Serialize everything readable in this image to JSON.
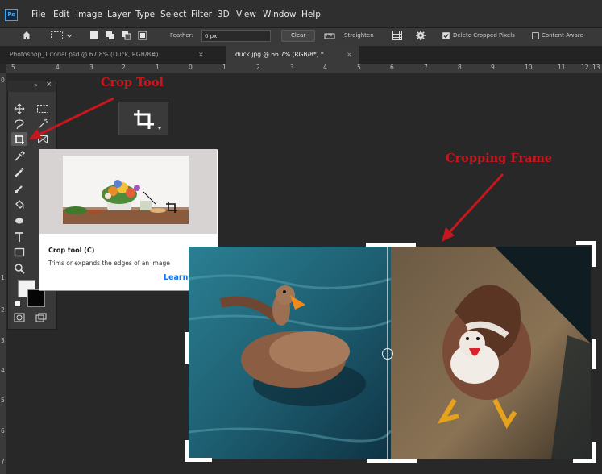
{
  "app": {
    "logo_text": "Ps"
  },
  "menu": [
    "File",
    "Edit",
    "Image",
    "Layer",
    "Type",
    "Select",
    "Filter",
    "3D",
    "View",
    "Window",
    "Help"
  ],
  "options_bar": {
    "feather_label": "Feather:",
    "feather_value": "0 px",
    "clear_label": "Clear",
    "straighten_label": "Straighten",
    "delete_cropped_label": "Delete Cropped Pixels",
    "delete_cropped_checked": true,
    "content_aware_label": "Content-Aware",
    "content_aware_checked": false
  },
  "tabs": [
    {
      "label": "Photoshop_Tutorial.psd @ 67.8% (Duck, RGB/8#)",
      "active": false,
      "close": "×"
    },
    {
      "label": "duck.jpg @ 66.7% (RGB/8*) *",
      "active": true,
      "close": "×"
    }
  ],
  "ruler_top_ticks": [
    "5",
    "4",
    "3",
    "2",
    "1",
    "0",
    "1",
    "2",
    "3",
    "4",
    "5",
    "6",
    "7",
    "8",
    "9",
    "10",
    "11",
    "12",
    "13"
  ],
  "ruler_left_ticks": [
    "0",
    "1",
    "2",
    "3",
    "4",
    "5",
    "6",
    "7"
  ],
  "toolbar": {
    "collapse_label": "»",
    "close_label": "×"
  },
  "tooltip": {
    "title": "Crop tool (C)",
    "description": "Trims or expands the edges of an image",
    "link": "Learn how"
  },
  "annotations": {
    "crop_tool": "Crop Tool",
    "cropping_frame": "Cropping Frame"
  },
  "colors": {
    "accent": "#31a8ff",
    "annotation_red": "#c8161d",
    "link_blue": "#1473e6"
  }
}
